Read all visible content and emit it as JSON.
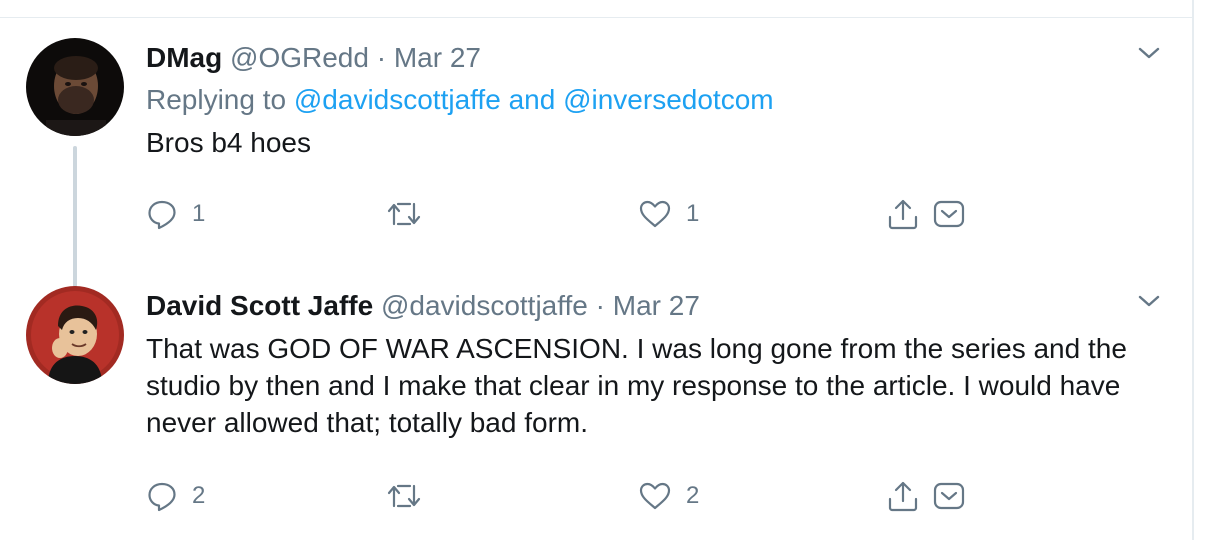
{
  "tweets": [
    {
      "name": "DMag",
      "handle": "@OGRedd",
      "separator": "·",
      "date": "Mar 27",
      "replying_prefix": "Replying to",
      "replying_to": [
        "@davidscottjaffe",
        "@inversedotcom"
      ],
      "replying_joiner": "and",
      "text": "Bros b4 hoes",
      "replies": "1",
      "retweets": "",
      "likes": "1",
      "avatar_icon": "user-avatar-photo"
    },
    {
      "name": "David Scott Jaffe",
      "handle": "@davidscottjaffe",
      "separator": "·",
      "date": "Mar 27",
      "text": "That was GOD OF WAR ASCENSION. I was long gone from the series and the studio by then and I make that clear in my response to the article. I would have never allowed that; totally bad form.",
      "replies": "2",
      "retweets": "",
      "likes": "2",
      "avatar_icon": "cartoon-avatar"
    }
  ],
  "colors": {
    "text": "#14171a",
    "secondary": "#657786",
    "link": "#1da1f2",
    "border": "#e6ecf0",
    "thread_line": "#ccd6dd"
  }
}
